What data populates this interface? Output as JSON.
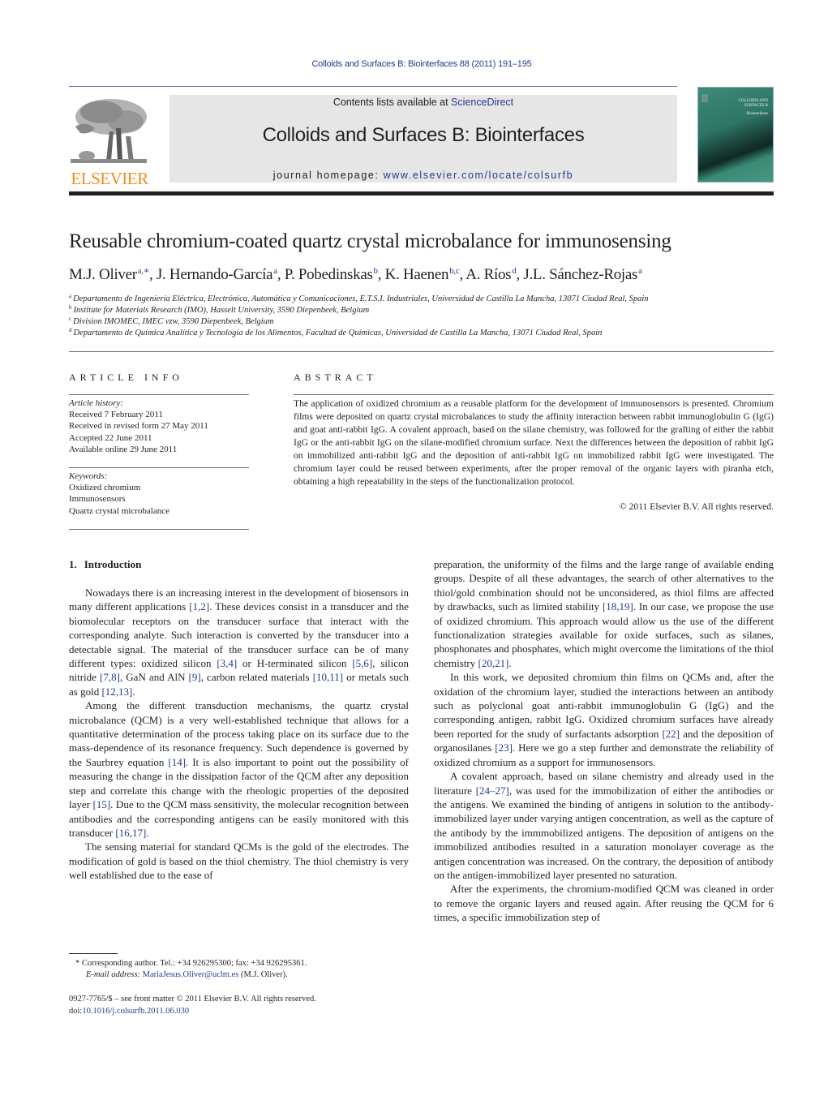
{
  "header": {
    "journal_reference": "Colloids and Surfaces B: Biointerfaces 88 (2011) 191–195",
    "contents_prefix": "Contents lists available at ",
    "contents_link": "ScienceDirect",
    "journal_title": "Colloids and Surfaces B: Biointerfaces",
    "homepage_prefix": "journal homepage: ",
    "homepage_link": "www.elsevier.com/locate/colsurfb",
    "publisher_logo_text": "ELSEVIER",
    "cover_title_line1": "COLLOIDS AND",
    "cover_title_line2": "SURFACES B",
    "cover_subtitle": "Biointerfaces"
  },
  "colors": {
    "link": "#253a8d",
    "elsevier_orange": "#f28c1e",
    "banner_bg": "#e6e6e6",
    "cover_green": "#2e7565"
  },
  "article": {
    "title": "Reusable chromium-coated quartz crystal microbalance for immunosensing",
    "authors": [
      {
        "name": "M.J. Oliver",
        "sup": "a,∗"
      },
      {
        "name": "J. Hernando-García",
        "sup": "a"
      },
      {
        "name": "P. Pobedinskas",
        "sup": "b"
      },
      {
        "name": "K. Haenen",
        "sup": "b,c"
      },
      {
        "name": "A. Ríos",
        "sup": "d"
      },
      {
        "name": "J.L. Sánchez-Rojas",
        "sup": "a"
      }
    ],
    "affiliations": [
      {
        "key": "a",
        "text": "Departamento de Ingeniería Eléctrica, Electrónica, Automática y Comunicaciones, E.T.S.I. Industriales, Universidad de Castilla La Mancha, 13071 Ciudad Real, Spain"
      },
      {
        "key": "b",
        "text": "Institute for Materials Research (IMO), Hasselt University, 3590 Diepenbeek, Belgium"
      },
      {
        "key": "c",
        "text": "Division IMOMEC, IMEC vzw, 3590 Diepenbeek, Belgium"
      },
      {
        "key": "d",
        "text": "Departamento de Química Analítica y Tecnología de los Alimentos, Facultad de Químicas, Universidad de Castilla La Mancha, 13071 Ciudad Real, Spain"
      }
    ]
  },
  "article_info": {
    "heading": "ARTICLE INFO",
    "history_label": "Article history:",
    "history": [
      "Received 7 February 2011",
      "Received in revised form 27 May 2011",
      "Accepted 22 June 2011",
      "Available online 29 June 2011"
    ],
    "keywords_label": "Keywords:",
    "keywords": [
      "Oxidized chromium",
      "Immunosensors",
      "Quartz crystal microbalance"
    ]
  },
  "abstract": {
    "heading": "ABSTRACT",
    "text": "The application of oxidized chromium as a reusable platform for the development of immunosensors is presented. Chromium films were deposited on quartz crystal microbalances to study the affinity interaction between rabbit immunoglobulin G (IgG) and goat anti-rabbit IgG. A covalent approach, based on the silane chemistry, was followed for the grafting of either the rabbit IgG or the anti-rabbit IgG on the silane-modified chromium surface. Next the differences between the deposition of rabbit IgG on immobilized anti-rabbit IgG and the deposition of anti-rabbit IgG on immobilized rabbit IgG were investigated. The chromium layer could be reused between experiments, after the proper removal of the organic layers with piranha etch, obtaining a high repeatability in the steps of the functionalization protocol.",
    "copyright": "© 2011 Elsevier B.V. All rights reserved."
  },
  "body": {
    "section_number": "1.",
    "section_title": "Introduction",
    "left_paragraphs": [
      [
        {
          "t": "Nowadays there is an increasing interest in the development of biosensors in many different applications "
        },
        {
          "r": "[1,2]"
        },
        {
          "t": ". These devices consist in a transducer and the biomolecular receptors on the transducer surface that interact with the corresponding analyte. Such interaction is converted by the transducer into a detectable signal. The material of the transducer surface can be of many different types: oxidized silicon "
        },
        {
          "r": "[3,4]"
        },
        {
          "t": " or H-terminated silicon "
        },
        {
          "r": "[5,6]"
        },
        {
          "t": ", silicon nitride "
        },
        {
          "r": "[7,8]"
        },
        {
          "t": ", GaN and AlN "
        },
        {
          "r": "[9]"
        },
        {
          "t": ", carbon related materials "
        },
        {
          "r": "[10,11]"
        },
        {
          "t": " or metals such as gold "
        },
        {
          "r": "[12,13]"
        },
        {
          "t": "."
        }
      ],
      [
        {
          "t": "Among the different transduction mechanisms, the quartz crystal microbalance (QCM) is a very well-established technique that allows for a quantitative determination of the process taking place on its surface due to the mass-dependence of its resonance frequency. Such dependence is governed by the Saurbrey equation "
        },
        {
          "r": "[14]"
        },
        {
          "t": ". It is also important to point out the possibility of measuring the change in the dissipation factor of the QCM after any deposition step and correlate this change with the rheologic properties of the deposited layer "
        },
        {
          "r": "[15]"
        },
        {
          "t": ". Due to the QCM mass sensitivity, the molecular recognition between antibodies and the corresponding antigens can be easily monitored with this transducer "
        },
        {
          "r": "[16,17]"
        },
        {
          "t": "."
        }
      ],
      [
        {
          "t": "The sensing material for standard QCMs is the gold of the electrodes. The modification of gold is based on the thiol chemistry. The thiol chemistry is very well established due to the ease of"
        }
      ]
    ],
    "right_paragraphs": [
      [
        {
          "t": "preparation, the uniformity of the films and the large range of available ending groups. Despite of all these advantages, the search of other alternatives to the thiol/gold combination should not be unconsidered, as thiol films are affected by drawbacks, such as limited stability "
        },
        {
          "r": "[18,19]"
        },
        {
          "t": ". In our case, we propose the use of oxidized chromium. This approach would allow us the use of the different functionalization strategies available for oxide surfaces, such as silanes, phosphonates and phosphates, which might overcome the limitations of the thiol chemistry "
        },
        {
          "r": "[20,21]"
        },
        {
          "t": "."
        }
      ],
      [
        {
          "t": "In this work, we deposited chromium thin films on QCMs and, after the oxidation of the chromium layer, studied the interactions between an antibody such as polyclonal goat anti-rabbit immunoglobulin G (IgG) and the corresponding antigen, rabbit IgG. Oxidized chromium surfaces have already been reported for the study of surfactants adsorption "
        },
        {
          "r": "[22]"
        },
        {
          "t": " and the deposition of organosilanes "
        },
        {
          "r": "[23]"
        },
        {
          "t": ". Here we go a step further and demonstrate the reliability of oxidized chromium as a support for immunosensors."
        }
      ],
      [
        {
          "t": "A covalent approach, based on silane chemistry and already used in the literature "
        },
        {
          "r": "[24–27]"
        },
        {
          "t": ", was used for the immobilization of either the antibodies or the antigens. We examined the binding of antigens in solution to the antibody-immobilized layer under varying antigen concentration, as well as the capture of the antibody by the immmobilized antigens. The deposition of antigens on the immobilized antibodies resulted in a saturation monolayer coverage as the antigen concentration was increased. On the contrary, the deposition of antibody on the antigen-immobilized layer presented no saturation."
        }
      ],
      [
        {
          "t": "After the experiments, the chromium-modified QCM was cleaned in order to remove the organic layers and reused again. After reusing the QCM for 6 times, a specific immobilization step of"
        }
      ]
    ]
  },
  "footnotes": {
    "corresponding": "* Corresponding author. Tel.: +34 926295300; fax: +34 926295361.",
    "email_label": "E-mail address: ",
    "email": "MariaJesus.Oliver@uclm.es",
    "email_suffix": " (M.J. Oliver).",
    "front_matter": "0927-7765/$ – see front matter © 2011 Elsevier B.V. All rights reserved.",
    "doi_prefix": "doi:",
    "doi": "10.1016/j.colsurfb.2011.06.030"
  }
}
